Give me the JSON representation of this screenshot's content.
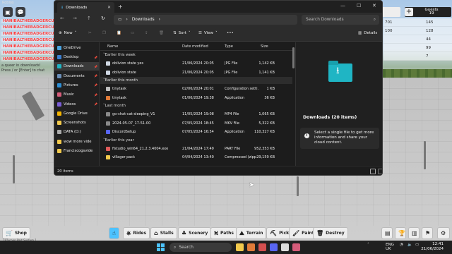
{
  "game": {
    "window_title": "Roblox",
    "chat": {
      "lines": [
        "HANIBALTHEBADGERCUT",
        "HANIBALTHEBADGERCUT",
        "HANIBALTHEBADGERCUT",
        "HANIBALTHEBADGERCUT",
        "HANIBALTHEBADGERCUT",
        "HANIBALTHEBADGERCUT",
        "HANIBALTHEBADGERCUT"
      ],
      "hint1": "a queer in downloads!",
      "hint2": "Press / or [Enter] to chat"
    },
    "leaderboard": {
      "header": "Guests",
      "header_value": "19",
      "rows": [
        {
          "a": "701",
          "b": "145"
        },
        {
          "a": "100",
          "b": "128"
        },
        {
          "a": "",
          "b": "44"
        },
        {
          "a": "",
          "b": "99"
        },
        {
          "a": "",
          "b": "7"
        }
      ]
    },
    "toolbar": {
      "shop": "Shop",
      "rides": "Rides",
      "stalls": "Stalls",
      "scenery": "Scenery",
      "paths": "Paths",
      "terrain": "Terrain",
      "pick": "Pick",
      "paint": "Paint",
      "destroy": "Destroy"
    },
    "watermark": "TPTycoon Part System 1"
  },
  "explorer": {
    "tab_title": "Downloads",
    "address": [
      "Downloads"
    ],
    "search_placeholder": "Search Downloads",
    "toolbar": {
      "new": "New",
      "sort": "Sort",
      "view": "View",
      "details": "Details"
    },
    "nav": [
      {
        "label": "OneDrive",
        "color": "#4aa3df"
      },
      {
        "label": "Desktop",
        "color": "#3b7fd1"
      },
      {
        "label": "Downloads",
        "color": "#1fb5c4",
        "active": true
      },
      {
        "label": "Documents",
        "color": "#6b8fb8"
      },
      {
        "label": "Pictures",
        "color": "#2e8fd6"
      },
      {
        "label": "Music",
        "color": "#d65c7a"
      },
      {
        "label": "Videos",
        "color": "#7a5cd6"
      },
      {
        "label": "Google Drive",
        "color": "#f4b400"
      },
      {
        "label": "Screenshots",
        "color": "#f2c94c"
      },
      {
        "label": "DATA (D:)",
        "color": "#aaaaaa"
      },
      {
        "label": "wow more vide",
        "color": "#f2c94c"
      },
      {
        "label": "Franciscogsvide",
        "color": "#f2c94c"
      }
    ],
    "columns": {
      "name": "Name",
      "date": "Date modified",
      "type": "Type",
      "size": "Size"
    },
    "groups": [
      {
        "label": "Earlier this week",
        "files": [
          {
            "name": "oblivion state yes",
            "date": "21/06/2024 20:05",
            "type": "JPG File",
            "size": "1,142 KB",
            "color": "#cfd8e3"
          },
          {
            "name": "oblivion state",
            "date": "21/06/2024 20:05",
            "type": "JPG File",
            "size": "1,141 KB",
            "color": "#cfd8e3"
          }
        ]
      },
      {
        "label": "Earlier this month",
        "files": [
          {
            "name": "tinytask",
            "date": "02/06/2024 20:01",
            "type": "Configuration setti...",
            "size": "1 KB",
            "color": "#bfbfbf"
          },
          {
            "name": "tinytask",
            "date": "01/06/2024 19:38",
            "type": "Application",
            "size": "36 KB",
            "color": "#e07b39"
          }
        ]
      },
      {
        "label": "Last month",
        "files": [
          {
            "name": "go-chat-cat-sleeping_V1",
            "date": "11/05/2024 19:08",
            "type": "MP4 File",
            "size": "1,065 KB",
            "color": "#8a8a8a"
          },
          {
            "name": "2024-05-07_17-51-00",
            "date": "07/05/2024 18:45",
            "type": "MKV File",
            "size": "5,322 KB",
            "color": "#8a8a8a"
          },
          {
            "name": "DiscordSetup",
            "date": "07/05/2024 16:54",
            "type": "Application",
            "size": "110,327 KB",
            "color": "#5865f2"
          }
        ]
      },
      {
        "label": "Earlier this year",
        "files": [
          {
            "name": "flstudio_win64_21.2.3.4004.exe",
            "date": "21/04/2024 17:49",
            "type": "PART File",
            "size": "952,353 KB",
            "color": "#e05a5a"
          },
          {
            "name": "villager pack",
            "date": "04/04/2024 13:40",
            "type": "Compressed (zipp...",
            "size": "29,159 KB",
            "color": "#f2c94c"
          }
        ]
      }
    ],
    "details_pane": {
      "title": "Downloads (20 items)",
      "message": "Select a single file to get more information and share your cloud content."
    },
    "status": "20 items"
  },
  "taskbar": {
    "search": "Search",
    "lang": "ENG",
    "region": "UK",
    "time": "12:41",
    "date": "21/06/2024"
  }
}
